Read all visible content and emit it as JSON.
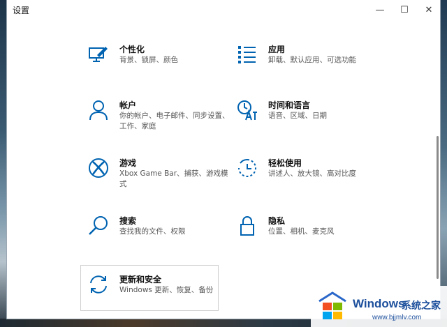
{
  "window": {
    "title": "设置",
    "controls": {
      "minimize": "—",
      "maximize": "☐",
      "close": "✕"
    }
  },
  "tiles": [
    {
      "name": "个性化",
      "desc": "背景、锁屏、颜色",
      "icon": "personalization-icon"
    },
    {
      "name": "应用",
      "desc": "卸载、默认应用、可选功能",
      "icon": "apps-icon"
    },
    {
      "name": "帐户",
      "desc": "你的帐户、电子邮件、同步设置、工作、家庭",
      "icon": "accounts-icon"
    },
    {
      "name": "时间和语言",
      "desc": "语音、区域、日期",
      "icon": "time-language-icon"
    },
    {
      "name": "游戏",
      "desc": "Xbox Game Bar、捕获、游戏模式",
      "icon": "xbox-icon"
    },
    {
      "name": "轻松使用",
      "desc": "讲述人、放大镜、高对比度",
      "icon": "ease-of-access-icon"
    },
    {
      "name": "搜索",
      "desc": "查找我的文件、权限",
      "icon": "search-icon"
    },
    {
      "name": "隐私",
      "desc": "位置、相机、麦克风",
      "icon": "lock-icon"
    },
    {
      "name": "更新和安全",
      "desc": "Windows 更新、恢复、备份",
      "icon": "sync-icon"
    }
  ],
  "watermark": {
    "brand": "Windows",
    "cn": "系统之家",
    "url": "www.bjjmlv.com"
  },
  "colors": {
    "accent": "#0063b1",
    "watermark": "#1c4f9c"
  }
}
